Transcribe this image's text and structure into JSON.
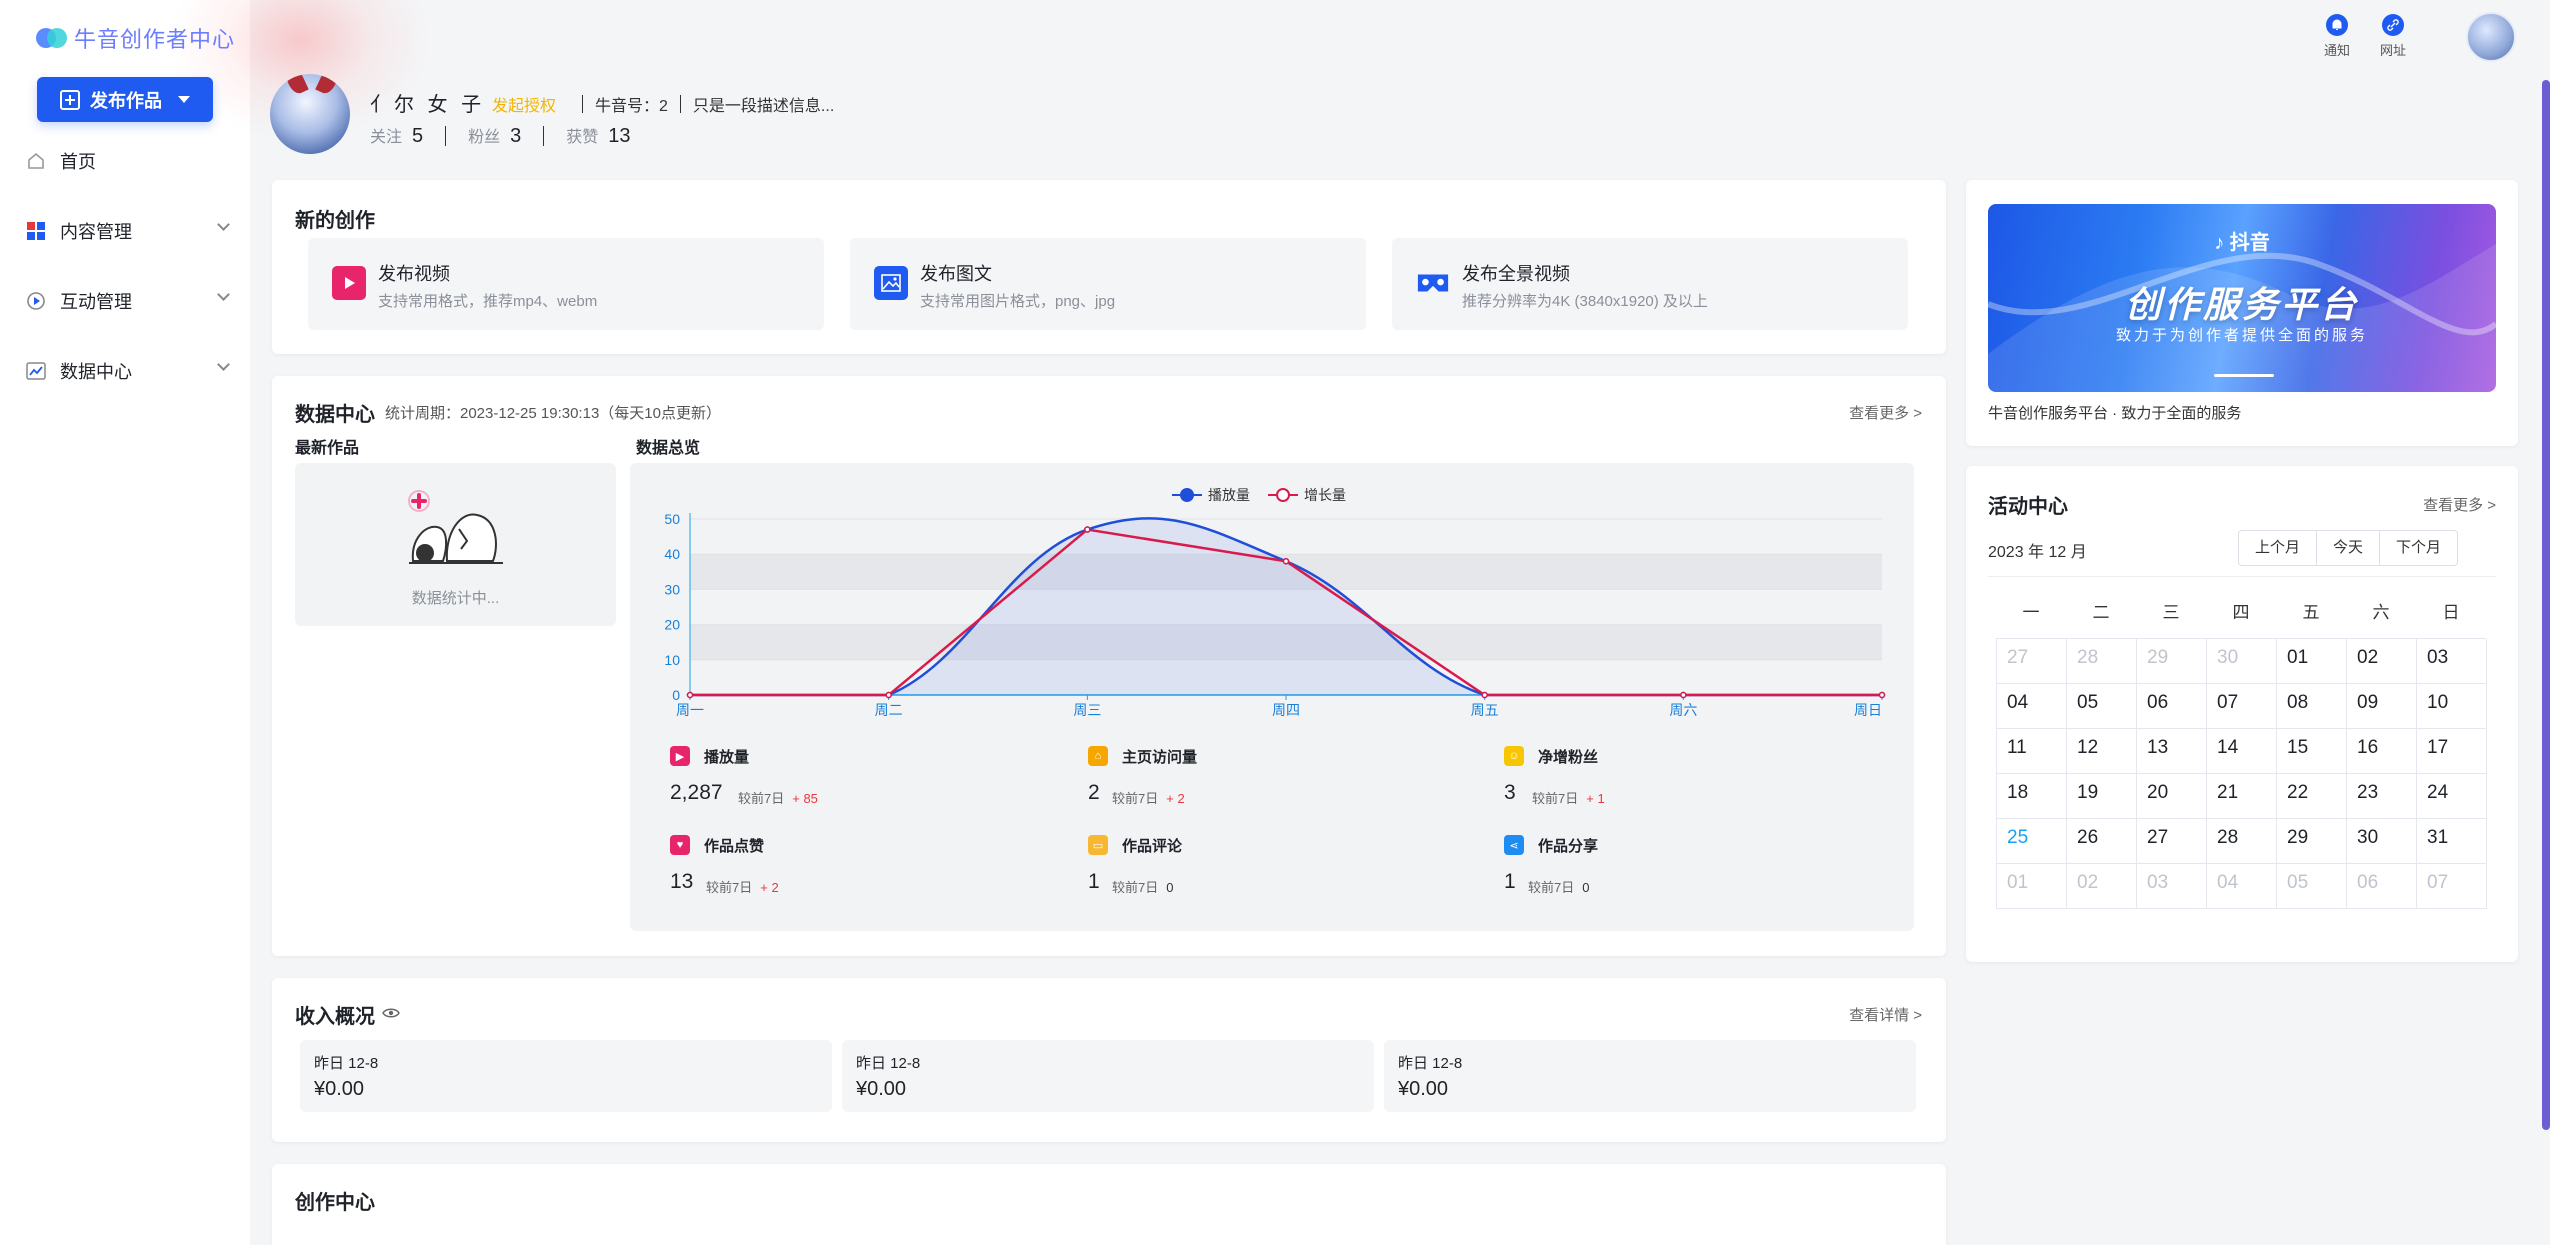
{
  "app": {
    "logo_text": "牛音创作者中心",
    "publish_button": "发布作品"
  },
  "sidebar": {
    "items": [
      {
        "label": "首页",
        "icon": "home-icon"
      },
      {
        "label": "内容管理",
        "icon": "content-grid-icon"
      },
      {
        "label": "互动管理",
        "icon": "interaction-icon"
      },
      {
        "label": "数据中心",
        "icon": "data-chart-icon"
      }
    ]
  },
  "topbar": {
    "notify_label": "通知",
    "url_label": "网址"
  },
  "profile": {
    "name": "亻尔 女 子",
    "auth_link": "发起授权",
    "id_text": "牛音号：2",
    "description": "只是一段描述信息...",
    "stats": [
      {
        "label": "关注",
        "value": "5"
      },
      {
        "label": "粉丝",
        "value": "3"
      },
      {
        "label": "获赞",
        "value": "13"
      }
    ]
  },
  "new_creation": {
    "title": "新的创作",
    "items": [
      {
        "title": "发布视频",
        "desc": "支持常用格式，推荐mp4、webm",
        "color": "#e8246b"
      },
      {
        "title": "发布图文",
        "desc": "支持常用图片格式，png、jpg",
        "color": "#1f5bf1"
      },
      {
        "title": "发布全景视频",
        "desc": "推荐分辨率为4K (3840x1920) 及以上",
        "color": "#1f5bf1"
      }
    ]
  },
  "data_center": {
    "title": "数据中心",
    "period": "统计周期：2023-12-25 19:30:13（每天10点更新）",
    "more": "查看更多 >",
    "latest_label": "最新作品",
    "latest_empty": "数据统计中...",
    "overview_label": "数据总览",
    "stats": [
      {
        "label": "播放量",
        "value": "2,287",
        "cmp": "较前7日",
        "delta": "+ 85",
        "color": "#e8246b",
        "icon": "play-icon"
      },
      {
        "label": "主页访问量",
        "value": "2",
        "cmp": "较前7日",
        "delta": "+ 2",
        "color": "#f7a600",
        "icon": "home-visit-icon"
      },
      {
        "label": "净增粉丝",
        "value": "3",
        "cmp": "较前7日",
        "delta": "+ 1",
        "color": "#f7c600",
        "icon": "fans-icon"
      },
      {
        "label": "作品点赞",
        "value": "13",
        "cmp": "较前7日",
        "delta": "+ 2",
        "color": "#e8246b",
        "icon": "heart-icon"
      },
      {
        "label": "作品评论",
        "value": "1",
        "cmp": "较前7日",
        "delta": "0",
        "color": "#f7b733",
        "icon": "comment-icon"
      },
      {
        "label": "作品分享",
        "value": "1",
        "cmp": "较前7日",
        "delta": "0",
        "color": "#1f8cf1",
        "icon": "share-icon"
      }
    ]
  },
  "chart_data": {
    "type": "line",
    "categories": [
      "周一",
      "周二",
      "周三",
      "周四",
      "周五",
      "周六",
      "周日"
    ],
    "series": [
      {
        "name": "播放量",
        "values": [
          0,
          0,
          47,
          38,
          0,
          0,
          0
        ],
        "color": "#1f4fd8",
        "smooth": true,
        "area": true
      },
      {
        "name": "增长量",
        "values": [
          0,
          0,
          47,
          38,
          0,
          0,
          0
        ],
        "color": "#d81b4a",
        "smooth": false,
        "area": false
      }
    ],
    "yticks": [
      0,
      10,
      20,
      30,
      40,
      50
    ],
    "ylim": [
      0,
      50
    ],
    "legend": "top-center",
    "grid": true
  },
  "income": {
    "title": "收入概况",
    "more": "查看详情 >",
    "items": [
      {
        "date": "昨日  12-8",
        "amount": "¥0.00"
      },
      {
        "date": "昨日  12-8",
        "amount": "¥0.00"
      },
      {
        "date": "昨日  12-8",
        "amount": "¥0.00"
      }
    ]
  },
  "creation_center": {
    "title": "创作中心"
  },
  "banner": {
    "brand": "抖音",
    "title": "创作服务平台",
    "subtitle": "致力于为创作者提供全面的服务",
    "caption": "牛音创作服务平台 · 致力于全面的服务"
  },
  "activity": {
    "title": "活动中心",
    "more": "查看更多 >",
    "month_label": "2023 年 12 月",
    "buttons": [
      "上个月",
      "今天",
      "下个月"
    ],
    "weekdays": [
      "一",
      "二",
      "三",
      "四",
      "五",
      "六",
      "日"
    ],
    "days": [
      {
        "d": "27",
        "o": true
      },
      {
        "d": "28",
        "o": true
      },
      {
        "d": "29",
        "o": true
      },
      {
        "d": "30",
        "o": true
      },
      {
        "d": "01"
      },
      {
        "d": "02"
      },
      {
        "d": "03"
      },
      {
        "d": "04"
      },
      {
        "d": "05"
      },
      {
        "d": "06"
      },
      {
        "d": "07"
      },
      {
        "d": "08"
      },
      {
        "d": "09"
      },
      {
        "d": "10"
      },
      {
        "d": "11"
      },
      {
        "d": "12"
      },
      {
        "d": "13"
      },
      {
        "d": "14"
      },
      {
        "d": "15"
      },
      {
        "d": "16"
      },
      {
        "d": "17"
      },
      {
        "d": "18"
      },
      {
        "d": "19"
      },
      {
        "d": "20"
      },
      {
        "d": "21"
      },
      {
        "d": "22"
      },
      {
        "d": "23"
      },
      {
        "d": "24"
      },
      {
        "d": "25",
        "t": true
      },
      {
        "d": "26"
      },
      {
        "d": "27"
      },
      {
        "d": "28"
      },
      {
        "d": "29"
      },
      {
        "d": "30"
      },
      {
        "d": "31"
      },
      {
        "d": "01",
        "o": true
      },
      {
        "d": "02",
        "o": true
      },
      {
        "d": "03",
        "o": true
      },
      {
        "d": "04",
        "o": true
      },
      {
        "d": "05",
        "o": true
      },
      {
        "d": "06",
        "o": true
      },
      {
        "d": "07",
        "o": true
      }
    ]
  }
}
